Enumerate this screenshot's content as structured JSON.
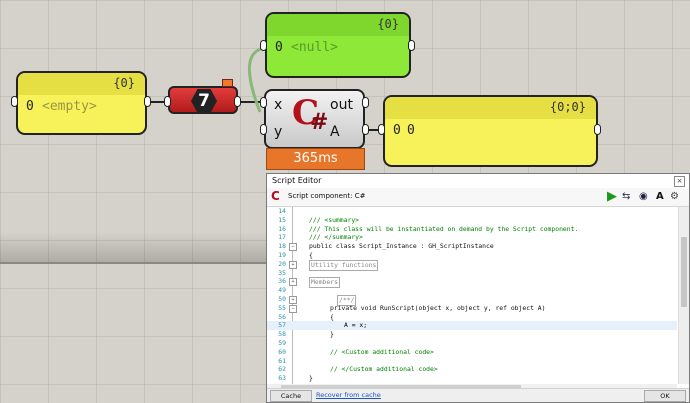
{
  "canvas": {
    "empty_panel": {
      "header": "{0}",
      "index": "0",
      "value": "<empty>"
    },
    "null_panel": {
      "header": "{0}",
      "index": "0",
      "value": "<null>"
    },
    "output_panel": {
      "header": "{0;0}",
      "index": "0",
      "value": "0"
    },
    "number_component": {
      "value": "7"
    },
    "csharp_component": {
      "logo": "C",
      "logo_sharp": "#",
      "inputs": [
        "x",
        "y"
      ],
      "outputs": [
        "out",
        "A"
      ],
      "timer": "365ms"
    }
  },
  "editor": {
    "window_title": "Script Editor",
    "close_symbol": "×",
    "component_title": "Script component: C#",
    "toolbar_icons": [
      "run-icon",
      "compare-icon",
      "preview-icon",
      "font-icon",
      "settings-icon"
    ],
    "lines": [
      {
        "n": "14",
        "text": "",
        "type": "plain"
      },
      {
        "n": "15",
        "text": "/// <summary>",
        "type": "comment"
      },
      {
        "n": "16",
        "text": "/// This class will be instantiated on demand by the Script component.",
        "type": "comment"
      },
      {
        "n": "17",
        "text": "/// </summary>",
        "type": "comment"
      },
      {
        "n": "18",
        "text": "public class Script_Instance : GH_ScriptInstance",
        "type": "class"
      },
      {
        "n": "19",
        "text": "{",
        "type": "plain"
      },
      {
        "n": "20",
        "text": "Utility functions",
        "type": "region"
      },
      {
        "n": "35",
        "text": "",
        "type": "plain"
      },
      {
        "n": "36",
        "text": "Members",
        "type": "region"
      },
      {
        "n": "49",
        "text": "",
        "type": "plain"
      },
      {
        "n": "50",
        "text": "/**/",
        "type": "region"
      },
      {
        "n": "55",
        "text": "private void RunScript(object x, object y, ref object A)",
        "type": "method"
      },
      {
        "n": "56",
        "text": "{",
        "type": "plain"
      },
      {
        "n": "57",
        "text": "A = x;",
        "type": "current"
      },
      {
        "n": "58",
        "text": "}",
        "type": "plain"
      },
      {
        "n": "59",
        "text": "",
        "type": "plain"
      },
      {
        "n": "60",
        "text": "// <Custom additional code>",
        "type": "comment"
      },
      {
        "n": "61",
        "text": "",
        "type": "plain"
      },
      {
        "n": "62",
        "text": "// </Custom additional code>",
        "type": "comment"
      },
      {
        "n": "63",
        "text": "}",
        "type": "plain"
      }
    ],
    "footer": {
      "cache_button": "Cache",
      "recover_link": "Recover from cache",
      "ok_button": "OK"
    }
  }
}
